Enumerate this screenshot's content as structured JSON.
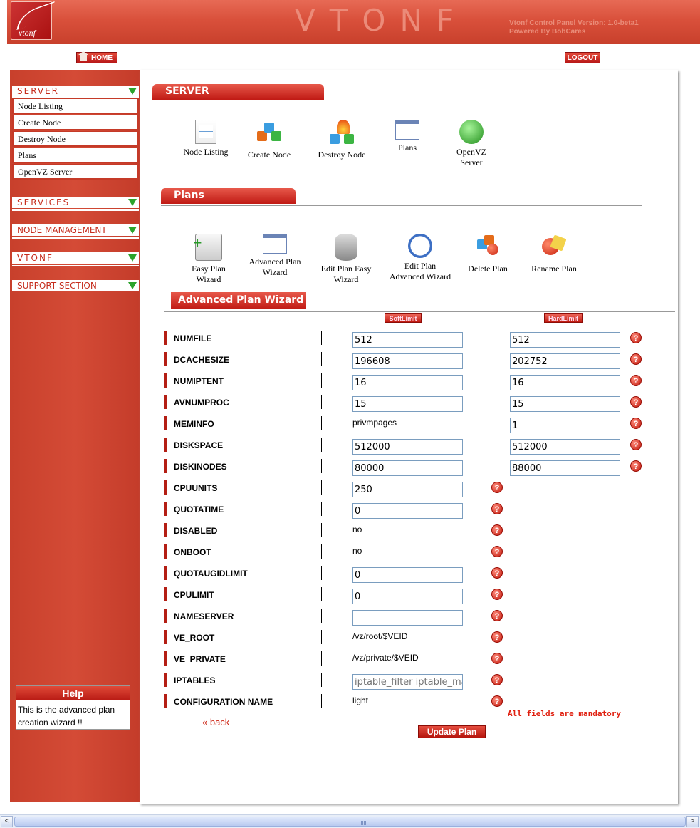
{
  "header": {
    "logo_text": "vtonf",
    "brand": "VTONF",
    "version_line1": "Vtonf Control Panel Version: 1.0-beta1",
    "version_line2": "Powered By BobCares"
  },
  "nav": {
    "home": "HOME",
    "logout": "LOGOUT"
  },
  "sidebar": {
    "server": "SERVER",
    "server_items": [
      "Node Listing",
      "Create Node",
      "Destroy Node",
      "Plans",
      "OpenVZ Server"
    ],
    "services": "SERVICES",
    "node_management": "NODE MANAGEMENT",
    "vtonf": "VTONF",
    "support": "SUPPORT SECTION"
  },
  "help": {
    "title": "Help",
    "text": "This is the advanced plan creation wizard !!"
  },
  "server_section": {
    "title": "SERVER",
    "icons": [
      {
        "label": "Node Listing",
        "icon": "notepad-icon"
      },
      {
        "label": "Create Node",
        "icon": "cubes-icon"
      },
      {
        "label": "Destroy Node",
        "icon": "fire-cubes-icon"
      },
      {
        "label": "Plans",
        "icon": "plans-icon"
      },
      {
        "label": "OpenVZ Server",
        "icon": "globe-icon"
      }
    ]
  },
  "plans_section": {
    "title": "Plans",
    "icons": [
      {
        "label": "Easy Plan Wizard",
        "icon": "server-add-icon"
      },
      {
        "label": "Advanced Plan Wizard",
        "icon": "users-window-icon"
      },
      {
        "label": "Edit Plan Easy Wizard",
        "icon": "database-icon"
      },
      {
        "label": "Edit Plan Advanced Wizard",
        "icon": "clock-icon"
      },
      {
        "label": "Delete Plan",
        "icon": "delete-cubes-icon"
      },
      {
        "label": "Rename Plan",
        "icon": "rename-icon"
      }
    ]
  },
  "wizard": {
    "title": "Advanced Plan Wizard",
    "soft_limit": "SoftLimit",
    "hard_limit": "HardLimit",
    "rows": [
      {
        "label": "NUMFILE",
        "soft": "512",
        "hard": "512"
      },
      {
        "label": "DCACHESIZE",
        "soft": "196608",
        "hard": "202752"
      },
      {
        "label": "NUMIPTENT",
        "soft": "16",
        "hard": "16"
      },
      {
        "label": "AVNUMPROC",
        "soft": "15",
        "hard": "15"
      },
      {
        "label": "MEMINFO",
        "soft_text": "privmpages",
        "hard": "1"
      },
      {
        "label": "DISKSPACE",
        "soft": "512000",
        "hard": "512000"
      },
      {
        "label": "DISKINODES",
        "soft": "80000",
        "hard": "88000"
      },
      {
        "label": "CPUUNITS",
        "soft": "250"
      },
      {
        "label": "QUOTATIME",
        "soft": "0"
      },
      {
        "label": "DISABLED",
        "soft_text": "no"
      },
      {
        "label": "ONBOOT",
        "soft_text": "no"
      },
      {
        "label": "QUOTAUGIDLIMIT",
        "soft": "0"
      },
      {
        "label": "CPULIMIT",
        "soft": "0"
      },
      {
        "label": "NAMESERVER",
        "soft": ""
      },
      {
        "label": "VE_ROOT",
        "soft_text": "/vz/root/$VEID"
      },
      {
        "label": "VE_PRIVATE",
        "soft_text": "/vz/private/$VEID"
      },
      {
        "label": "IPTABLES",
        "placeholder": "iptable_filter iptable_mangle"
      },
      {
        "label": "CONFIGURATION NAME",
        "soft_text": "light"
      }
    ],
    "help_glyph": "?",
    "mandatory_note": "All fields are mandatory",
    "back": "« back",
    "update": "Update Plan"
  },
  "scrollbar": {
    "left_arrow": "<",
    "right_arrow": ">"
  },
  "colors": {
    "header_red": "#d9503b",
    "button_red": "#c01a14",
    "sidebar_red": "#c8402c"
  }
}
